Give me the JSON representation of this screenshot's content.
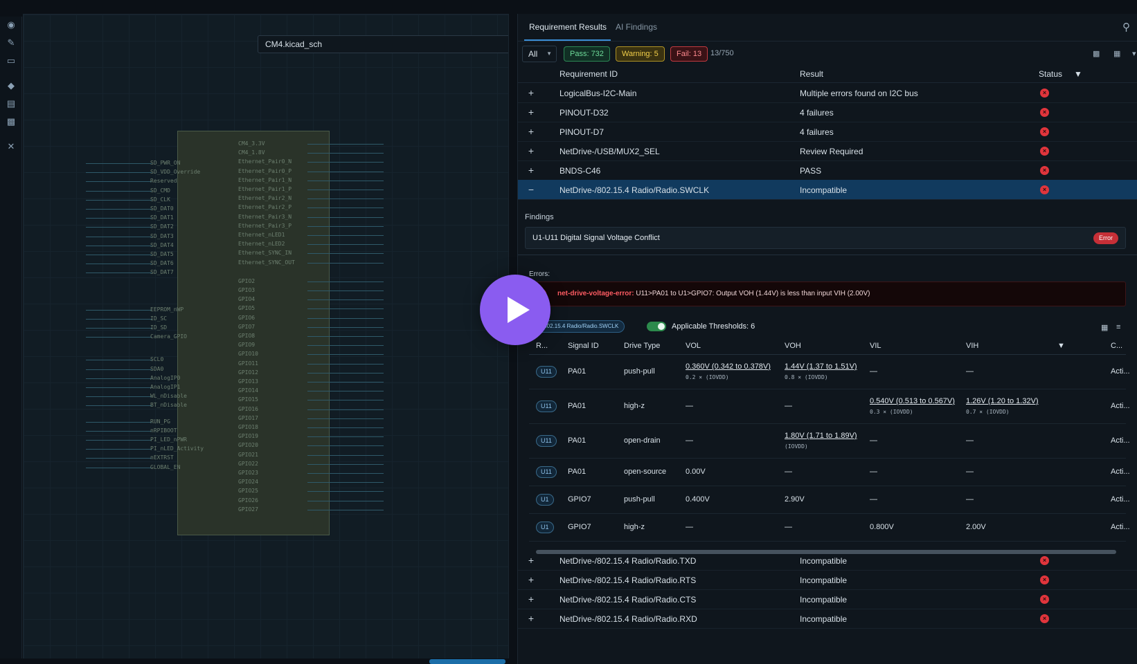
{
  "schematic": {
    "file": "CM4.kicad_sch",
    "pins_left": [
      "SD_PWR_ON",
      "SD_VDD_Override",
      "Reserved",
      "SD_CMD",
      "SD_CLK",
      "SD_DAT0",
      "SD_DAT1",
      "SD_DAT2",
      "SD_DAT3",
      "SD_DAT4",
      "SD_DAT5",
      "SD_DAT6",
      "SD_DAT7",
      "EEPROM_nWP",
      "ID_SC",
      "ID_SD",
      "Camera_GPIO",
      "SCL0",
      "SDA0",
      "AnalogIP0",
      "AnalogIP1",
      "WL_nDisable",
      "BT_nDisable",
      "RUN_PG",
      "nRPIBOOT",
      "PI_LED_nPWR",
      "PI_nLED_Activity",
      "nEXTRST",
      "GLOBAL_EN"
    ],
    "pins_right": [
      "CM4_3.3V",
      "CM4_1.8V",
      "Ethernet_Pair0_N",
      "Ethernet_Pair0_P",
      "Ethernet_Pair1_N",
      "Ethernet_Pair1_P",
      "Ethernet_Pair2_N",
      "Ethernet_Pair2_P",
      "Ethernet_Pair3_N",
      "Ethernet_Pair3_P",
      "Ethernet_nLED1",
      "Ethernet_nLED2",
      "Ethernet_SYNC_IN",
      "Ethernet_SYNC_OUT",
      "GPIO2",
      "GPIO3",
      "GPIO4",
      "GPIO5",
      "GPIO6",
      "GPIO7",
      "GPIO8",
      "GPIO9",
      "GPIO10",
      "GPIO11",
      "GPIO12",
      "GPIO13",
      "GPIO14",
      "GPIO15",
      "GPIO16",
      "GPIO17",
      "GPIO18",
      "GPIO19",
      "GPIO20",
      "GPIO21",
      "GPIO22",
      "GPIO23",
      "GPIO24",
      "GPIO25",
      "GPIO26",
      "GPIO27"
    ]
  },
  "tabs": [
    "Requirement Results",
    "AI Findings"
  ],
  "filter": {
    "selected": "All",
    "pass": "Pass: 732",
    "warning": "Warning: 5",
    "fail": "Fail: 13",
    "count": "13/750"
  },
  "columns": {
    "id": "Requirement ID",
    "result": "Result",
    "status": "Status"
  },
  "rows_top": [
    {
      "exp": "+",
      "id": "LogicalBus-I2C-Main",
      "result": "Multiple errors found on I2C bus"
    },
    {
      "exp": "+",
      "id": "PINOUT-D32",
      "result": "4 failures"
    },
    {
      "exp": "+",
      "id": "PINOUT-D7",
      "result": "4 failures"
    },
    {
      "exp": "+",
      "id": "NetDrive-/USB/MUX2_SEL",
      "result": "Review Required"
    },
    {
      "exp": "+",
      "id": "BNDS-C46",
      "result": "PASS"
    },
    {
      "exp": "−",
      "id": "NetDrive-/802.15.4 Radio/Radio.SWCLK",
      "result": "Incompatible"
    }
  ],
  "findings": {
    "label": "Findings",
    "title": "U1-U11 Digital Signal Voltage Conflict",
    "badge": "Error",
    "errors_label": "Errors:",
    "error_code": "net-drive-voltage-error:",
    "error_text": " U11>PA01 to U1>GPIO7: Output VOH (1.44V) is less than input VIH (2.00V)",
    "signal_chip": "/802.15.4 Radio/Radio.SWCLK",
    "thresholds": "Applicable Thresholds: 6"
  },
  "sub_columns": [
    "R...",
    "Signal ID",
    "Drive Type",
    "VOL",
    "VOH",
    "VIL",
    "VIH",
    "C..."
  ],
  "sub_rows": [
    {
      "ref": "U11",
      "sig": "PA01",
      "drive": "push-pull",
      "vol": "0.360V (0.342 to 0.378V)",
      "vol_sub": "0.2 × (IOVDD)",
      "voh": "1.44V (1.37 to 1.51V)",
      "voh_sub": "0.8 × (IOVDD)",
      "vil": "—",
      "vil_sub": "",
      "vih": "—",
      "vih_sub": "",
      "c": "Acti..."
    },
    {
      "ref": "U11",
      "sig": "PA01",
      "drive": "high-z",
      "vol": "—",
      "vol_sub": "",
      "voh": "—",
      "voh_sub": "",
      "vil": "0.540V (0.513 to 0.567V)",
      "vil_sub": "0.3 × (IOVDD)",
      "vih": "1.26V (1.20 to 1.32V)",
      "vih_sub": "0.7 × (IOVDD)",
      "c": "Acti..."
    },
    {
      "ref": "U11",
      "sig": "PA01",
      "drive": "open-drain",
      "vol": "—",
      "vol_sub": "",
      "voh": "1.80V (1.71 to 1.89V)",
      "voh_sub": "(IOVDD)",
      "vil": "—",
      "vil_sub": "",
      "vih": "—",
      "vih_sub": "",
      "c": "Acti..."
    },
    {
      "ref": "U11",
      "sig": "PA01",
      "drive": "open-source",
      "vol": "0.00V",
      "vol_sub": "",
      "voh": "—",
      "voh_sub": "",
      "vil": "—",
      "vil_sub": "",
      "vih": "—",
      "vih_sub": "",
      "c": "Acti..."
    },
    {
      "ref": "U1",
      "sig": "GPIO7",
      "drive": "push-pull",
      "vol": "0.400V",
      "vol_sub": "",
      "voh": "2.90V",
      "voh_sub": "",
      "vil": "—",
      "vil_sub": "",
      "vih": "—",
      "vih_sub": "",
      "c": "Acti..."
    },
    {
      "ref": "U1",
      "sig": "GPIO7",
      "drive": "high-z",
      "vol": "—",
      "vol_sub": "",
      "voh": "—",
      "voh_sub": "",
      "vil": "0.800V",
      "vil_sub": "",
      "vih": "2.00V",
      "vih_sub": "",
      "c": "Acti..."
    }
  ],
  "rows_bottom": [
    {
      "exp": "+",
      "id": "NetDrive-/802.15.4 Radio/Radio.TXD",
      "result": "Incompatible"
    },
    {
      "exp": "+",
      "id": "NetDrive-/802.15.4 Radio/Radio.RTS",
      "result": "Incompatible"
    },
    {
      "exp": "+",
      "id": "NetDrive-/802.15.4 Radio/Radio.CTS",
      "result": "Incompatible"
    },
    {
      "exp": "+",
      "id": "NetDrive-/802.15.4 Radio/Radio.RXD",
      "result": "Incompatible"
    }
  ],
  "icons": {
    "status": "fail-x-icon",
    "play": "play-icon"
  },
  "colors": {
    "accent": "#3b8ed6",
    "fail": "#e0353c",
    "pass": "#2c8a55",
    "warning": "#b09426",
    "play": "#8a5cf0"
  }
}
